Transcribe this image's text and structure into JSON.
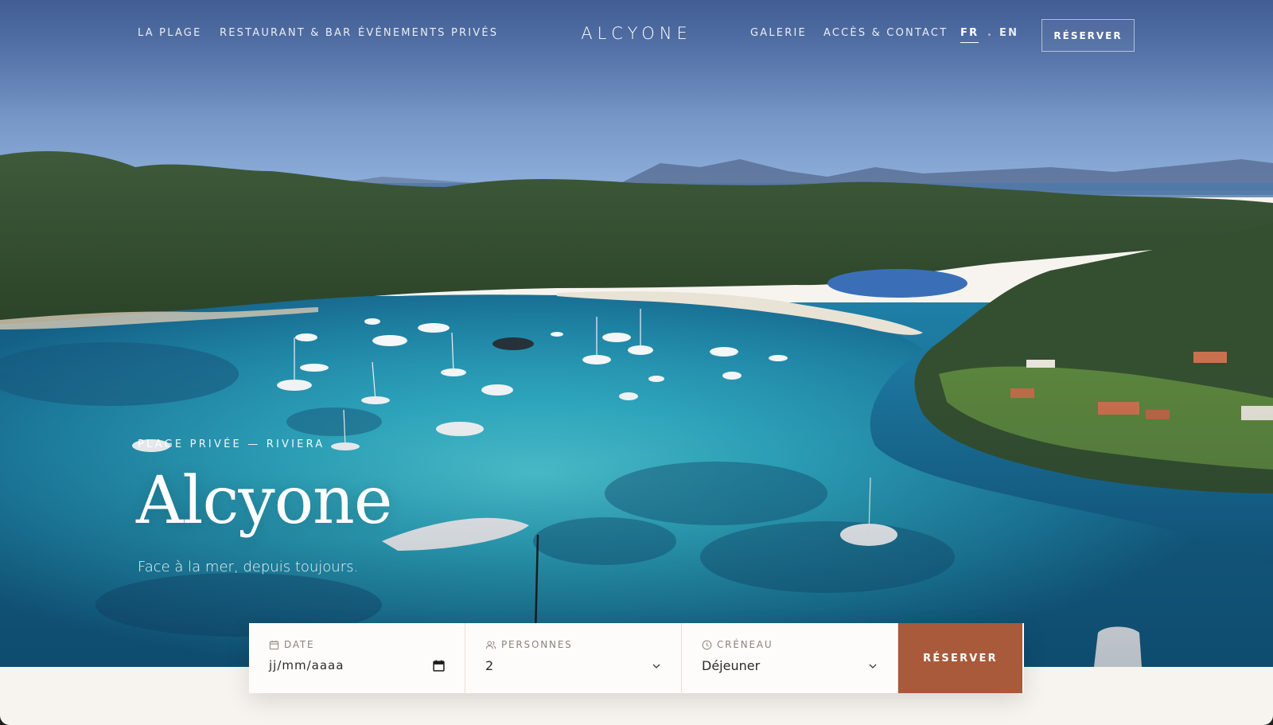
{
  "nav": {
    "left_links": [
      "LA PLAGE",
      "RESTAURANT & BAR",
      "ÉVÉNEMENTS PRIVÉS"
    ],
    "brand": "ALCYONE",
    "right_links": [
      "GALERIE",
      "ACCÈS & CONTACT"
    ],
    "languages": [
      {
        "code": "FR",
        "active": true
      },
      {
        "code": "EN",
        "active": false
      }
    ],
    "cta_label": "RÉSERVER"
  },
  "hero": {
    "eyebrow": "PLAGE PRIVÉE — RIVIERA",
    "title": "Alcyone",
    "tagline": "Face à la mer, depuis toujours.",
    "image_icon": "aerial-bay-photo"
  },
  "booking": {
    "date": {
      "label": "DATE",
      "icon": "calendar-icon",
      "placeholder": "jj/mm/aaaa"
    },
    "guests": {
      "label": "PERSONNES",
      "icon": "people-icon",
      "value": "2"
    },
    "slot": {
      "label": "CRÉNEAU",
      "icon": "clock-icon",
      "value": "Déjeuner"
    },
    "submit_label": "RÉSERVER"
  },
  "colors": {
    "accent": "#a85a3b",
    "page_background": "#f7f4ef",
    "booking_background": "#fdfcfa"
  }
}
